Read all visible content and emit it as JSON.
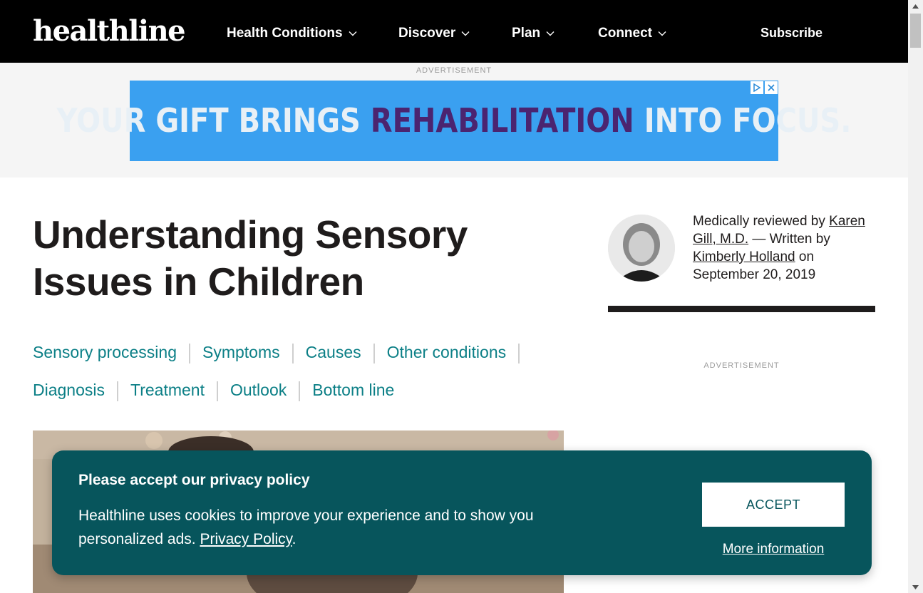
{
  "header": {
    "logo": "healthline",
    "nav": [
      {
        "label": "Health Conditions"
      },
      {
        "label": "Discover"
      },
      {
        "label": "Plan"
      },
      {
        "label": "Connect"
      }
    ],
    "subscribe": "Subscribe"
  },
  "top_ad": {
    "label": "ADVERTISEMENT",
    "text_before": "YOUR GIFT BRINGS ",
    "text_highlight": "REHABILITATION",
    "text_after": " INTO FOCUS.",
    "bg_color": "#3aa0f0",
    "highlight_color": "#4b2470"
  },
  "article": {
    "title": "Understanding Sensory Issues in Children",
    "toc": [
      "Sensory processing",
      "Symptoms",
      "Causes",
      "Other conditions",
      "Diagnosis",
      "Treatment",
      "Outlook",
      "Bottom line"
    ]
  },
  "byline": {
    "reviewed_prefix": "Medically reviewed by ",
    "reviewer": "Karen Gill, M.D.",
    "written_prefix": " — Written by ",
    "author": "Kimberly Holland",
    "date_prefix": " on ",
    "date": "September 20, 2019"
  },
  "side_ad": {
    "label": "ADVERTISEMENT"
  },
  "cookie_banner": {
    "title": "Please accept our privacy policy",
    "text": "Healthline uses cookies to improve your experience and to show you personalized ads. ",
    "policy_link": "Privacy Policy",
    "text_end": ".",
    "accept": "ACCEPT",
    "more_info": "More information",
    "bg_color": "#07555c"
  },
  "colors": {
    "link_teal": "#0b7f86",
    "header_bg": "#000000"
  }
}
